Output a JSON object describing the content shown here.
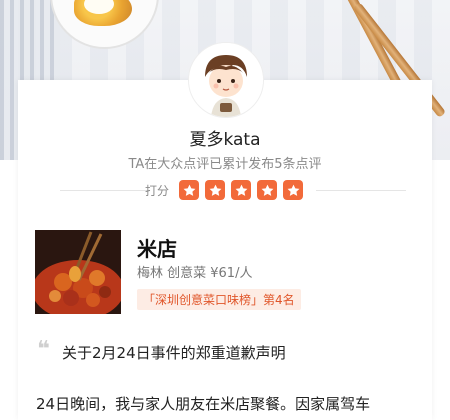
{
  "profile": {
    "username": "夏多kata",
    "subtitle": "TA在大众点评已累计发布5条点评",
    "rating_label": "打分",
    "rating_value": 5,
    "rating_max": 5
  },
  "shop": {
    "name": "米店",
    "meta": "梅林  创意菜  ¥61/人",
    "rank": "「深圳创意菜口味榜」第4名"
  },
  "review": {
    "quote_icon": "quote-icon",
    "headline": "关于2月24日事件的郑重道歉声明",
    "body_line": "24日晚间，我与家人朋友在米店聚餐。因家属驾车"
  },
  "colors": {
    "star_bg": "#f26a3a",
    "rank_text": "#e0562a",
    "rank_bg": "#fdece4"
  }
}
